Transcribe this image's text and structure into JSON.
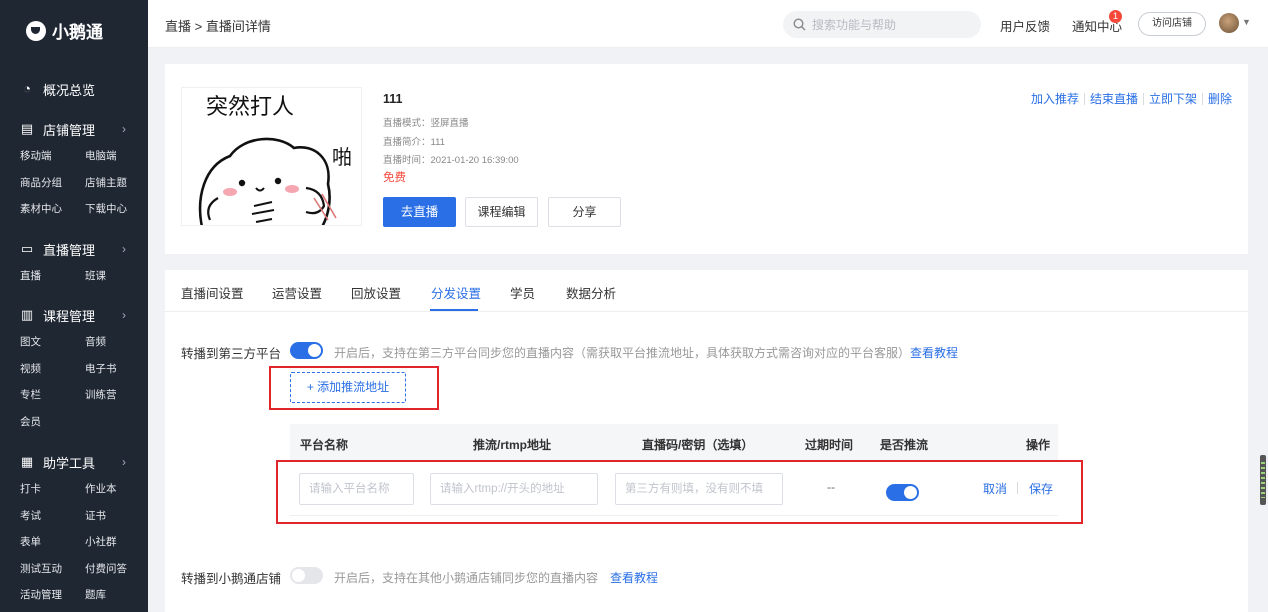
{
  "brand": {
    "name": "小鹅通"
  },
  "sidebar": {
    "groups": [
      {
        "title": "概况总览",
        "icon": "dashboard-icon",
        "items": []
      },
      {
        "title": "店铺管理",
        "icon": "store-icon",
        "items": [
          "移动端",
          "电脑端",
          "商品分组",
          "店铺主题",
          "素材中心",
          "下载中心"
        ]
      },
      {
        "title": "直播管理",
        "icon": "live-icon",
        "items": [
          "直播",
          "班课"
        ]
      },
      {
        "title": "课程管理",
        "icon": "course-icon",
        "items": [
          "图文",
          "音频",
          "视频",
          "电子书",
          "专栏",
          "训练营",
          "会员"
        ]
      },
      {
        "title": "助学工具",
        "icon": "tools-icon",
        "items": [
          "打卡",
          "作业本",
          "考试",
          "证书",
          "表单",
          "小社群",
          "测试互动",
          "付费问答",
          "活动管理",
          "题库"
        ]
      }
    ]
  },
  "topbar": {
    "breadcrumb": "直播 > 直播间详情",
    "search_placeholder": "搜索功能与帮助",
    "feedback": "用户反馈",
    "notify": "通知中心",
    "notify_count": "1",
    "visit_store": "访问店铺"
  },
  "live": {
    "title": "111",
    "mode": "直播模式：竖屏直播",
    "intro": "直播简介：111",
    "time": "直播时间：2021-01-20 16:39:00",
    "price": "免费",
    "buttons": {
      "go_live": "去直播",
      "edit": "课程编辑",
      "share": "分享"
    },
    "cover_text_top": "突然打人",
    "cover_text_side": "啪",
    "actions": [
      "加入推荐",
      "结束直播",
      "立即下架",
      "删除"
    ]
  },
  "tabs": [
    "直播间设置",
    "运营设置",
    "回放设置",
    "分发设置",
    "学员",
    "数据分析"
  ],
  "active_tab": "分发设置",
  "distribution": {
    "third_party": {
      "label": "转播到第三方平台",
      "enabled": true,
      "hint": "开启后，支持在第三方平台同步您的直播内容（需获取平台推流地址，具体获取方式需咨询对应的平台客服）",
      "link": "查看教程",
      "add_button": "+ 添加推流地址"
    },
    "table": {
      "headers": [
        "平台名称",
        "推流/rtmp地址",
        "直播码/密钥（选填）",
        "过期时间",
        "是否推流",
        "操作"
      ],
      "row": {
        "name_placeholder": "请输入平台名称",
        "url_placeholder": "请输入rtmp://开头的地址",
        "key_placeholder": "第三方有则填，没有则不填",
        "expire": "--",
        "push_enabled": true,
        "cancel": "取消",
        "save": "保存"
      }
    },
    "xiaoe_store": {
      "label": "转播到小鹅通店铺",
      "enabled": false,
      "hint": "开启后，支持在其他小鹅通店铺同步您的直播内容",
      "link": "查看教程"
    }
  },
  "colors": {
    "primary": "#2a6fe5",
    "sidebar": "#1f2733",
    "danger": "#f5483b",
    "highlight_box": "#e0262a"
  }
}
